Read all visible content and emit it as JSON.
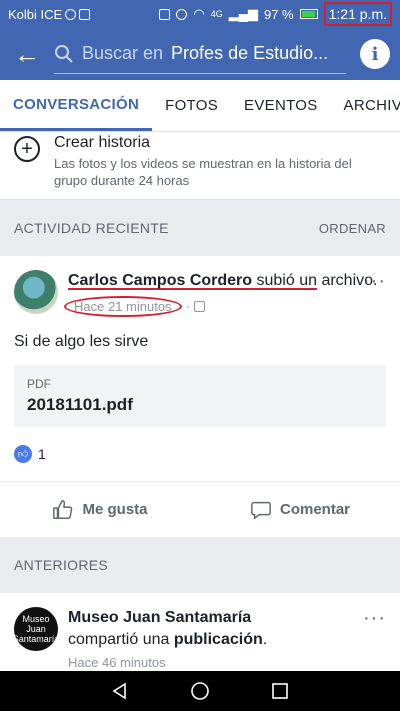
{
  "status": {
    "carrier": "Kolbi ICE",
    "network": "4G",
    "battery": "97 %",
    "time": "1:21 p.m."
  },
  "appbar": {
    "search_placeholder": "Buscar en",
    "group_name": "Profes de Estudio..."
  },
  "tabs": [
    "CONVERSACIÓN",
    "FOTOS",
    "EVENTOS",
    "ARCHIVOS"
  ],
  "story": {
    "title": "Crear historia",
    "subtitle": "Las fotos y los videos se muestran en la historia del grupo durante 24 horas"
  },
  "recent": {
    "heading": "ACTIVIDAD RECIENTE",
    "order": "ORDENAR"
  },
  "post": {
    "author": "Carlos Campos Cordero",
    "action": "subió un archivo.",
    "time": "Hace 21 minutos",
    "text": "Si de algo les sirve",
    "attachment": {
      "kind": "PDF",
      "name": "20181101.pdf"
    },
    "likes": "1",
    "like_label": "Me gusta",
    "comment_label": "Comentar"
  },
  "older": {
    "heading": "ANTERIORES"
  },
  "post2": {
    "author": "Museo Juan Santamaría",
    "action_pre": "compartió una",
    "action_obj": "publicación",
    "avatar_text": "Museo Juan Santamaría",
    "time": "Hace 46 minutos"
  },
  "icons": {
    "back": "arrow-left-icon",
    "search": "search-icon",
    "info": "info-icon",
    "more": "more-icon",
    "like": "thumbs-up-icon",
    "comment": "comment-icon"
  },
  "colors": {
    "brand": "#4267b2",
    "annotation": "#d3202f"
  }
}
